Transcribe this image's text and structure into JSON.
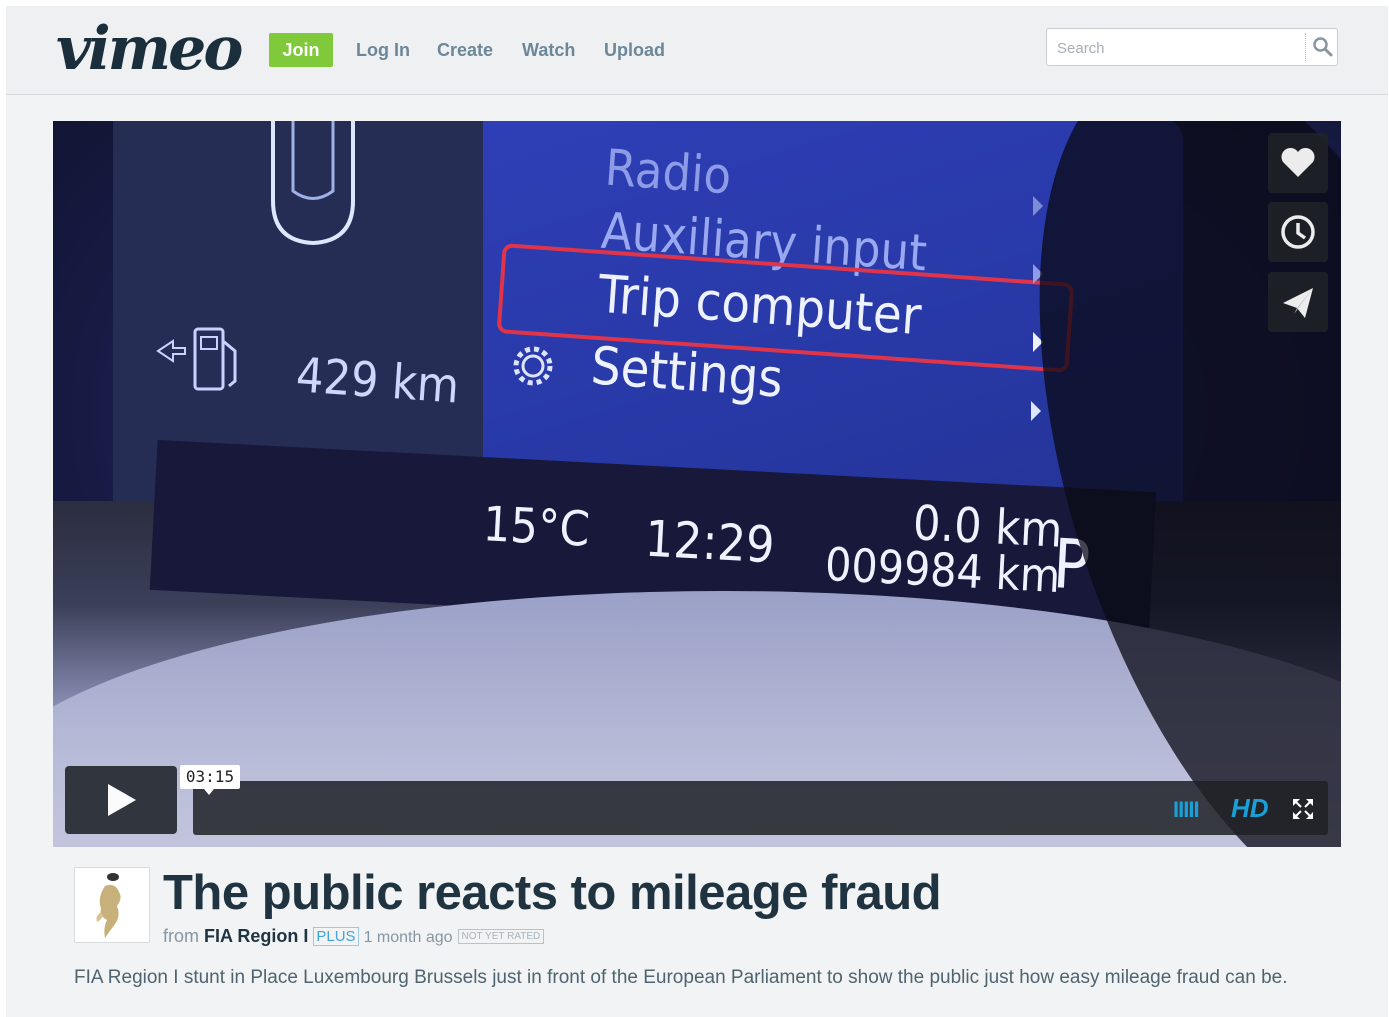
{
  "header": {
    "logo": "vimeo",
    "nav": {
      "join": "Join",
      "login": "Log In",
      "create": "Create",
      "watch": "Watch",
      "upload": "Upload"
    },
    "search": {
      "placeholder": "Search"
    }
  },
  "player": {
    "screen_text": {
      "menu_radio": "Radio",
      "menu_aux": "Auxiliary input",
      "menu_trip": "Trip computer",
      "menu_settings": "Settings",
      "range": "429 km",
      "temperature": "15°C",
      "clock": "12:29",
      "trip_distance": "0.0 km",
      "odometer": "009984 km",
      "gear": "P"
    },
    "duration": "03:15",
    "hd_label": "HD",
    "volume_label": "IIIII",
    "accent_color": "#19a0d9"
  },
  "video": {
    "title": "The public reacts to mileage fraud",
    "from_label": "from",
    "owner": "FIA Region I",
    "owner_badge": "PLUS",
    "posted": "1 month ago",
    "rating": "NOT YET RATED",
    "description": "FIA Region I stunt in Place Luxembourg Brussels just in front of the European Parliament to show the public just how easy mileage fraud can be."
  }
}
